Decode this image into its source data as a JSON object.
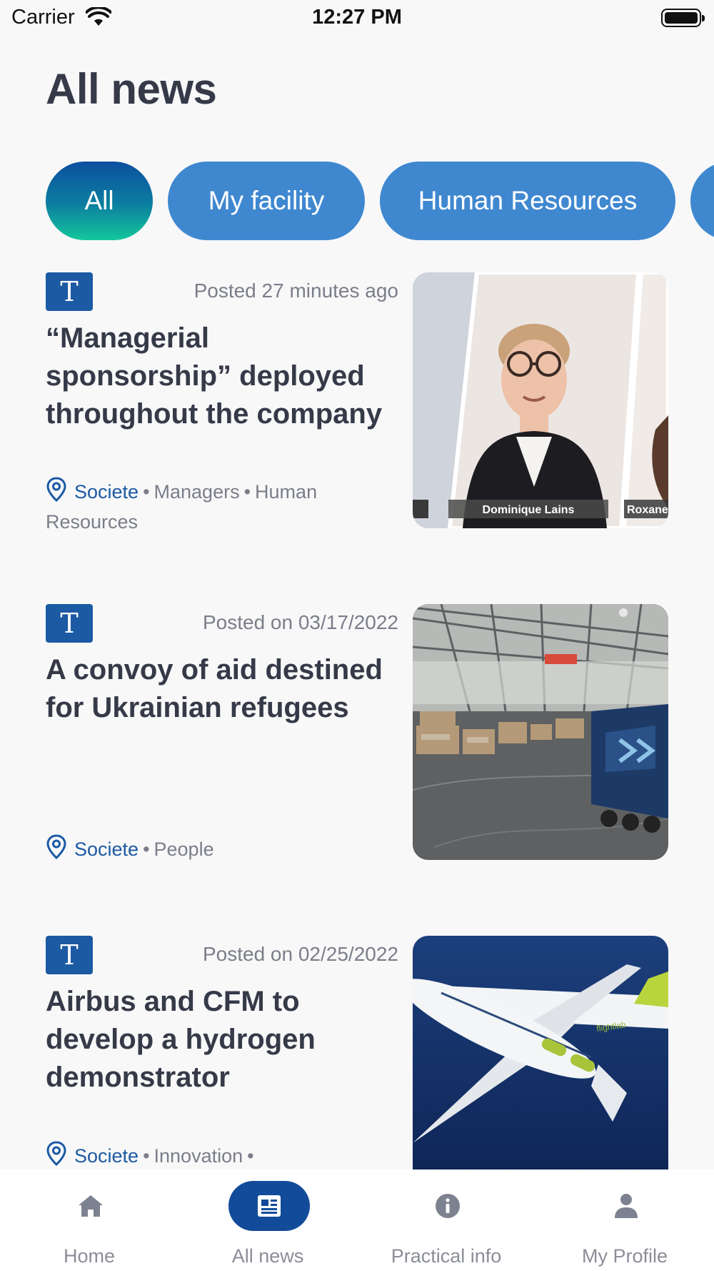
{
  "status_bar": {
    "carrier": "Carrier",
    "time": "12:27 PM"
  },
  "page": {
    "title": "All news"
  },
  "filters": [
    {
      "label": "All",
      "active": true
    },
    {
      "label": "My facility",
      "active": false
    },
    {
      "label": "Human Resources",
      "active": false
    },
    {
      "label": "",
      "active": false
    }
  ],
  "news": [
    {
      "badge": "T",
      "posted": "Posted 27 minutes ago",
      "title": "“Managerial sponsorship” deployed throughout the company",
      "location": "Societe",
      "tags": [
        "Managers",
        "Human Resources"
      ],
      "image_caption_1": "Dominique Lains",
      "image_caption_2": "Roxane"
    },
    {
      "badge": "T",
      "posted": "Posted on 03/17/2022",
      "title": "A convoy of aid destined for Ukrainian refugees",
      "location": "Societe",
      "tags": [
        "People"
      ]
    },
    {
      "badge": "T",
      "posted": "Posted on 02/25/2022",
      "title": "Airbus and CFM to develop a hydrogen demonstrator",
      "location": "Societe",
      "tags": [
        "Innovation",
        ""
      ],
      "image_caption_1": "flightlab"
    }
  ],
  "tabbar": {
    "tabs": [
      {
        "label": "Home",
        "icon": "home-icon",
        "active": false
      },
      {
        "label": "All news",
        "icon": "newspaper-icon",
        "active": true
      },
      {
        "label": "Practical info",
        "icon": "info-icon",
        "active": false
      },
      {
        "label": "My Profile",
        "icon": "person-icon",
        "active": false
      }
    ]
  },
  "colors": {
    "primary": "#1c5aa4",
    "chip": "#3f88d0",
    "active_tab": "#124b99",
    "text": "#363a48",
    "muted": "#7b7e89"
  }
}
